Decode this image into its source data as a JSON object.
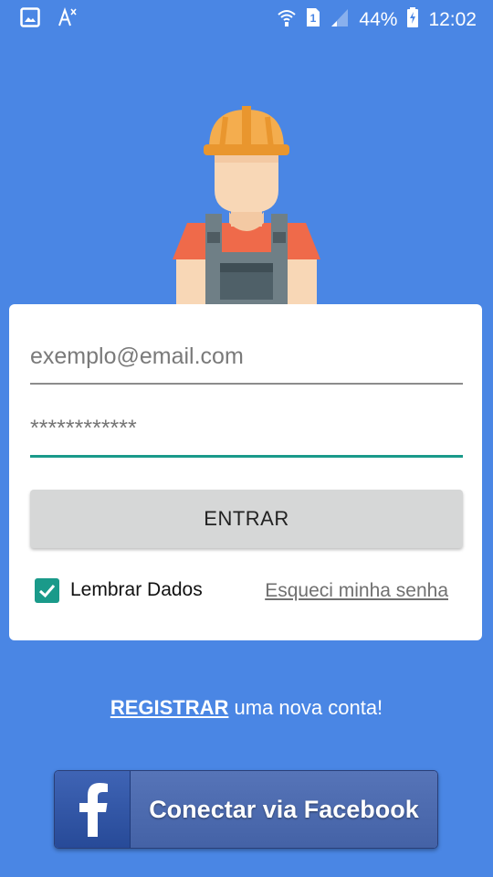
{
  "status_bar": {
    "battery": "44%",
    "time": "12:02",
    "sim_number": "1",
    "icons": [
      "gallery-icon",
      "translate-icon",
      "wifi-icon",
      "sim-icon",
      "signal-icon",
      "battery-charging-icon"
    ]
  },
  "illustration": {
    "icon": "construction-worker-icon"
  },
  "login": {
    "email_placeholder": "exemplo@email.com",
    "password_value": "************",
    "enter_label": "ENTRAR",
    "remember_label": "Lembrar Dados",
    "remember_checked": true,
    "forgot_label": "Esqueci minha senha"
  },
  "register": {
    "link_label": "REGISTRAR",
    "rest_text": " uma nova conta!"
  },
  "facebook": {
    "label": "Conectar via Facebook",
    "icon": "facebook-icon"
  },
  "colors": {
    "background": "#4a86e4",
    "accent": "#1a9a8a",
    "facebook": "#3b5998"
  }
}
